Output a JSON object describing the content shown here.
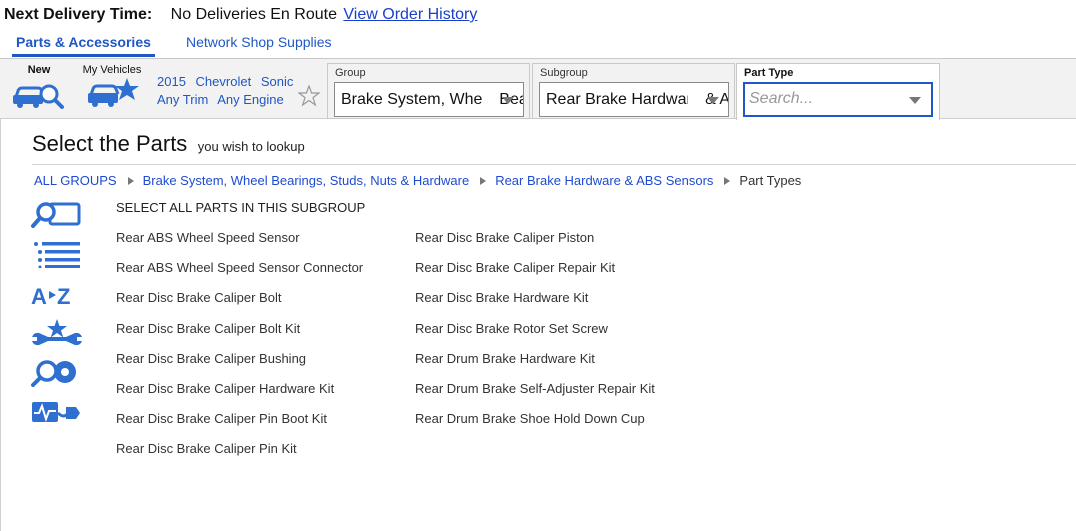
{
  "delivery": {
    "label": "Next Delivery Time:",
    "value": "No Deliveries En Route",
    "link": "View Order History"
  },
  "tabs": [
    {
      "label": "Parts & Accessories",
      "active": true
    },
    {
      "label": "Network Shop Supplies",
      "active": false
    }
  ],
  "vehicle_bar": {
    "new_label": "New",
    "my_vehicles_label": "My Vehicles",
    "year": "2015",
    "make": "Chevrolet",
    "model": "Sonic",
    "trim": "Any Trim",
    "engine": "Any Engine"
  },
  "filters": {
    "group": {
      "label": "Group",
      "value": "Brake System, Wheel Bearings, Studs, Nuts & Hardware"
    },
    "subgroup": {
      "label": "Subgroup",
      "value": "Rear Brake Hardware & ABS Sensors"
    },
    "part_type": {
      "label": "Part Type",
      "placeholder": "Search..."
    }
  },
  "main": {
    "title": "Select the Parts",
    "subtitle": "you wish to lookup",
    "breadcrumb": [
      "ALL GROUPS",
      "Brake System, Wheel Bearings, Studs, Nuts & Hardware",
      "Rear Brake Hardware & ABS Sensors",
      "Part Types"
    ],
    "select_all": "SELECT ALL PARTS IN THIS SUBGROUP",
    "parts_col1": [
      "Rear ABS Wheel Speed Sensor",
      "Rear ABS Wheel Speed Sensor Connector",
      "Rear Disc Brake Caliper Bolt",
      "Rear Disc Brake Caliper Bolt Kit",
      "Rear Disc Brake Caliper Bushing",
      "Rear Disc Brake Caliper Hardware Kit",
      "Rear Disc Brake Caliper Pin Boot Kit",
      "Rear Disc Brake Caliper Pin Kit"
    ],
    "parts_col2": [
      "Rear Disc Brake Caliper Piston",
      "Rear Disc Brake Caliper Repair Kit",
      "Rear Disc Brake Hardware Kit",
      "Rear Disc Brake Rotor Set Screw",
      "Rear Drum Brake Hardware Kit",
      "Rear Drum Brake Self-Adjuster Repair Kit",
      "Rear Drum Brake Shoe Hold Down Cup"
    ],
    "side_icons": [
      "search-part-icon",
      "list-view-icon",
      "a-to-z-icon",
      "tools-star-icon",
      "search-tire-icon",
      "diagnostic-icon"
    ]
  },
  "colors": {
    "brand_blue": "#1f57c5",
    "icon_blue": "#2e6fd0",
    "link_blue": "#1a3fcc"
  }
}
